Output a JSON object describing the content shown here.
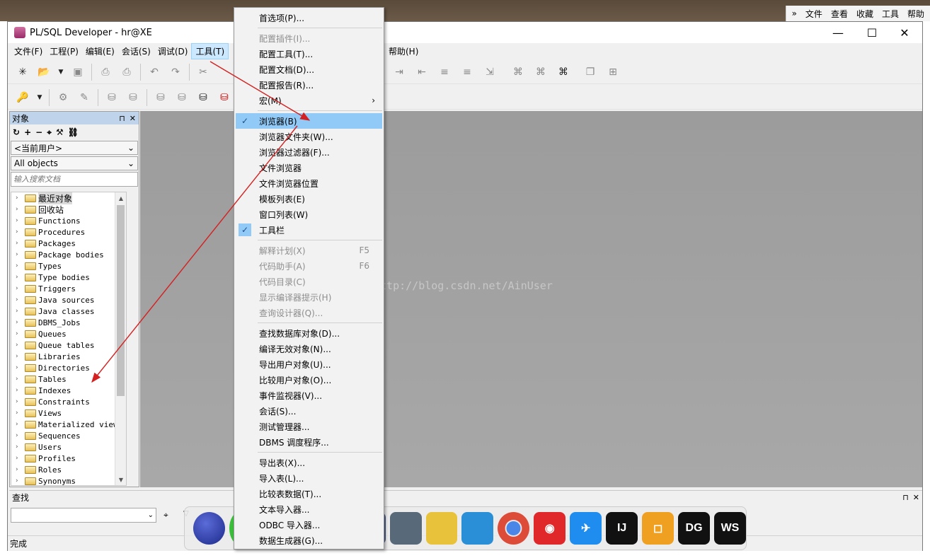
{
  "browser_menu": {
    "chevron": "»",
    "items": [
      "文件",
      "查看",
      "收藏",
      "工具",
      "帮助"
    ]
  },
  "window": {
    "title": "PL/SQL Developer - hr@XE",
    "minimize": "—",
    "maximize": "☐",
    "close": "✕"
  },
  "menubar": {
    "items": [
      "文件(F)",
      "工程(P)",
      "编辑(E)",
      "会话(S)",
      "调试(D)",
      "工具(T)"
    ],
    "help": "帮助(H)"
  },
  "object_panel": {
    "title": "对象",
    "pin": "⊓",
    "close": "✕",
    "owner_select": "<当前用户>",
    "filter_select": "All objects",
    "search_placeholder": "输入搜索文档",
    "tree": [
      "最近对象",
      "回收站",
      "Functions",
      "Procedures",
      "Packages",
      "Package bodies",
      "Types",
      "Type bodies",
      "Triggers",
      "Java sources",
      "Java classes",
      "DBMS_Jobs",
      "Queues",
      "Queue tables",
      "Libraries",
      "Directories",
      "Tables",
      "Indexes",
      "Constraints",
      "Views",
      "Materialized views",
      "Sequences",
      "Users",
      "Profiles",
      "Roles",
      "Synonyms"
    ]
  },
  "find_panel": {
    "title": "查找",
    "pin": "⊓",
    "close": "✕"
  },
  "status": {
    "text": "完成"
  },
  "dropdown": {
    "items": [
      {
        "label": "首选项(P)...",
        "disabled": false
      },
      {
        "label": "配置插件(I)...",
        "disabled": true
      },
      {
        "label": "配置工具(T)...",
        "disabled": false
      },
      {
        "label": "配置文档(D)...",
        "disabled": false
      },
      {
        "label": "配置报告(R)...",
        "disabled": false
      },
      {
        "label": "宏(M)",
        "disabled": false,
        "submenu": "›"
      },
      {
        "label": "浏览器(B)",
        "disabled": false,
        "checked": true,
        "selected": true
      },
      {
        "label": "浏览器文件夹(W)...",
        "disabled": false
      },
      {
        "label": "浏览器过滤器(F)...",
        "disabled": false
      },
      {
        "label": "文件浏览器",
        "disabled": false
      },
      {
        "label": "文件浏览器位置",
        "disabled": false
      },
      {
        "label": "模板列表(E)",
        "disabled": false
      },
      {
        "label": "窗口列表(W)",
        "disabled": false
      },
      {
        "label": "工具栏",
        "disabled": false,
        "checked": true
      },
      {
        "label": "解释计划(X)",
        "disabled": true,
        "shortcut": "F5"
      },
      {
        "label": "代码助手(A)",
        "disabled": true,
        "shortcut": "F6"
      },
      {
        "label": "代码目录(C)",
        "disabled": true
      },
      {
        "label": "显示编译器提示(H)",
        "disabled": true
      },
      {
        "label": "查询设计器(Q)...",
        "disabled": true
      },
      {
        "label": "查找数据库对象(D)...",
        "disabled": false
      },
      {
        "label": "编译无效对象(N)...",
        "disabled": false
      },
      {
        "label": "导出用户对象(U)...",
        "disabled": false
      },
      {
        "label": "比较用户对象(O)...",
        "disabled": false
      },
      {
        "label": "事件监视器(V)...",
        "disabled": false
      },
      {
        "label": "会话(S)...",
        "disabled": false
      },
      {
        "label": "测试管理器...",
        "disabled": false
      },
      {
        "label": "DBMS 调度程序...",
        "disabled": false
      },
      {
        "label": "导出表(X)...",
        "disabled": false
      },
      {
        "label": "导入表(L)...",
        "disabled": false
      },
      {
        "label": "比较表数据(T)...",
        "disabled": false
      },
      {
        "label": "文本导入器...",
        "disabled": false
      },
      {
        "label": "ODBC 导入器...",
        "disabled": false
      },
      {
        "label": "数据生成器(G)...",
        "disabled": false
      }
    ]
  },
  "watermark": "http://blog.csdn.net/AinUser",
  "dock": [
    "eclipse-icon",
    "app-icon",
    "app-icon",
    "remote-icon",
    "app-icon",
    "vpn-icon",
    "chrome-icon",
    "netease-music-icon",
    "dingtalk-icon",
    "IJ",
    "app-icon",
    "DG",
    "WS"
  ],
  "colors": {
    "menu_highlight": "#91c9f7",
    "arrow": "#d42020",
    "panel_header": "#bfd4ea"
  }
}
